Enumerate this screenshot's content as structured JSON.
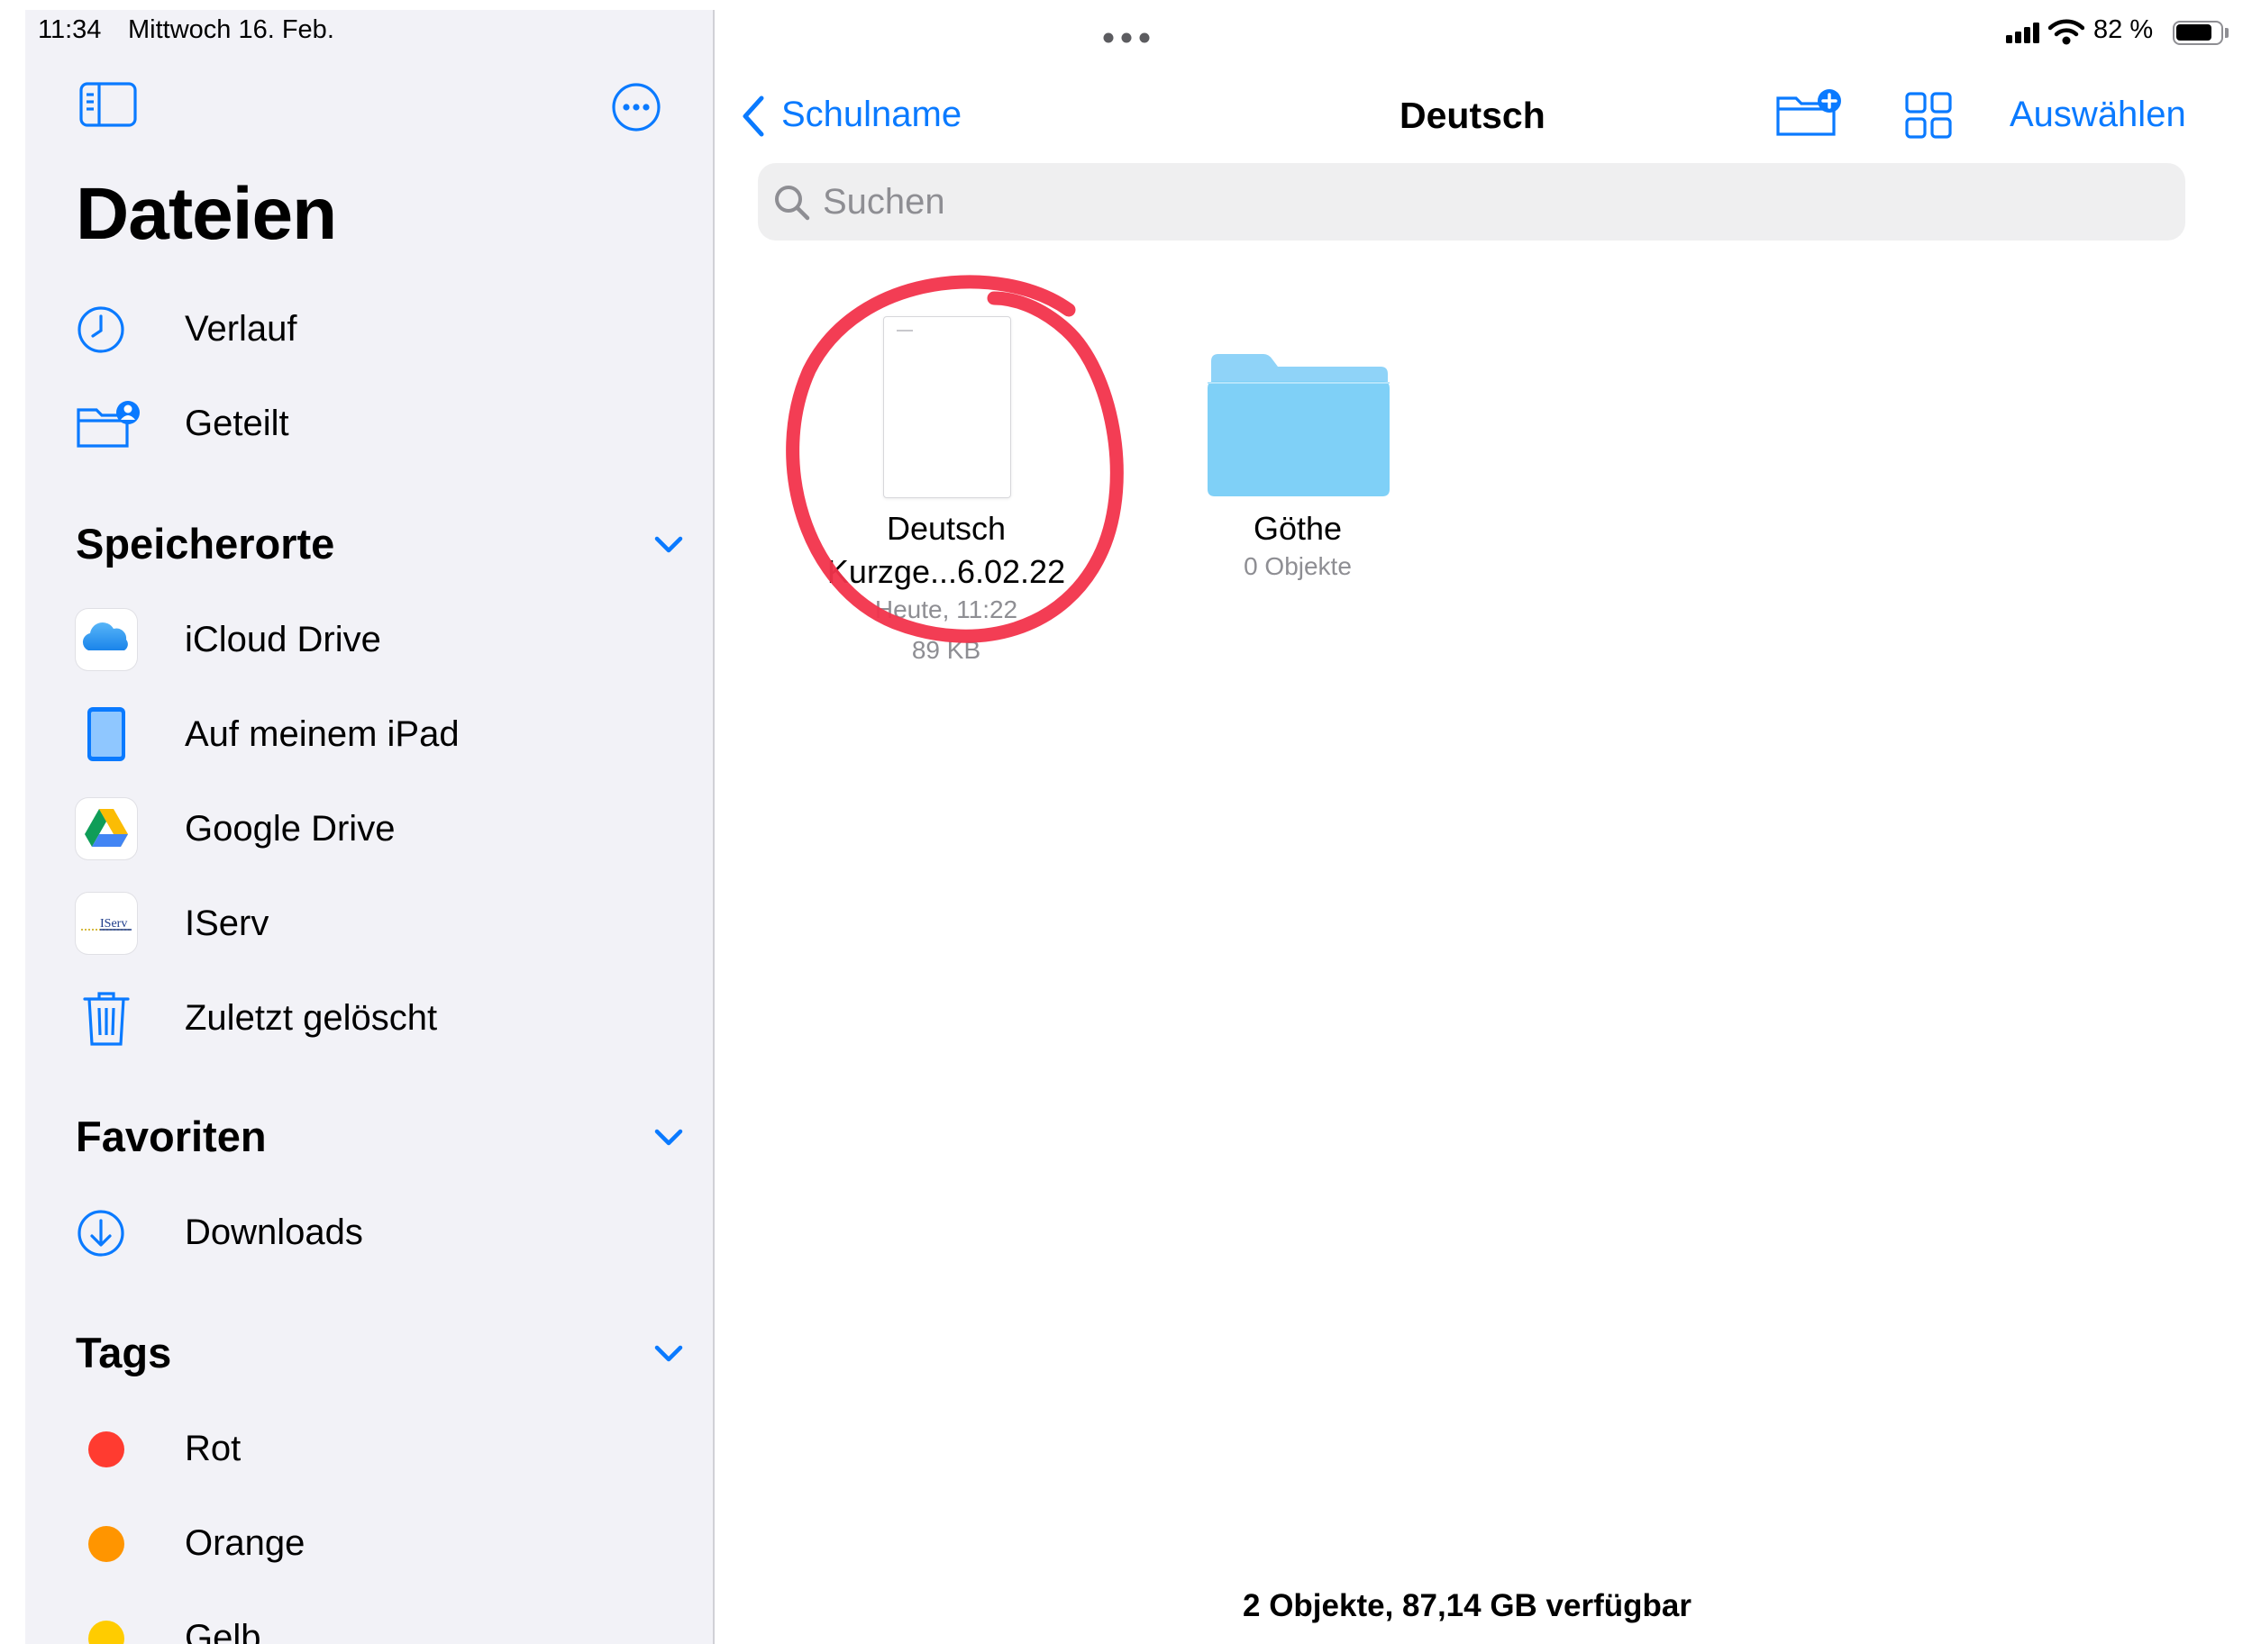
{
  "status_bar": {
    "time": "11:34",
    "date": "Mittwoch 16. Feb.",
    "battery_percent_label": "82 %",
    "battery_level": 0.82,
    "multitask_icon": "ellipsis-dots-icon"
  },
  "sidebar": {
    "title": "Dateien",
    "top_items": [
      {
        "label": "Verlauf",
        "icon": "clock-icon"
      },
      {
        "label": "Geteilt",
        "icon": "shared-folder-icon"
      }
    ],
    "sections": [
      {
        "title": "Speicherorte",
        "items": [
          {
            "label": "iCloud Drive",
            "icon": "icloud-icon"
          },
          {
            "label": "Auf meinem iPad",
            "icon": "ipad-icon"
          },
          {
            "label": "Google Drive",
            "icon": "google-drive-icon"
          },
          {
            "label": "IServ",
            "icon": "iserv-logo-icon",
            "logo_text": "IServ"
          },
          {
            "label": "Zuletzt gelöscht",
            "icon": "trash-icon"
          }
        ]
      },
      {
        "title": "Favoriten",
        "items": [
          {
            "label": "Downloads",
            "icon": "download-icon"
          }
        ]
      },
      {
        "title": "Tags",
        "items": [
          {
            "label": "Rot",
            "color": "#ff3b30"
          },
          {
            "label": "Orange",
            "color": "#ff9500"
          },
          {
            "label": "Gelb",
            "color": "#ffcc00"
          }
        ]
      }
    ]
  },
  "nav": {
    "back_label": "Schulname",
    "title": "Deutsch",
    "select_label": "Auswählen"
  },
  "search": {
    "placeholder": "Suchen",
    "value": ""
  },
  "items": [
    {
      "name_line1": "Deutsch",
      "name_line2": "Kurzge...6.02.22",
      "meta1": "Heute, 11:22",
      "meta2": "89 KB",
      "kind": "document"
    },
    {
      "name_line1": "Göthe",
      "meta1": "0 Objekte",
      "kind": "folder"
    }
  ],
  "footer": "2 Objekte, 87,14 GB verfügbar",
  "colors": {
    "accent": "#0a7aff",
    "sidebar_bg": "#f2f2f7",
    "folder": "#7fd0f7",
    "annotation": "#f2334b"
  }
}
